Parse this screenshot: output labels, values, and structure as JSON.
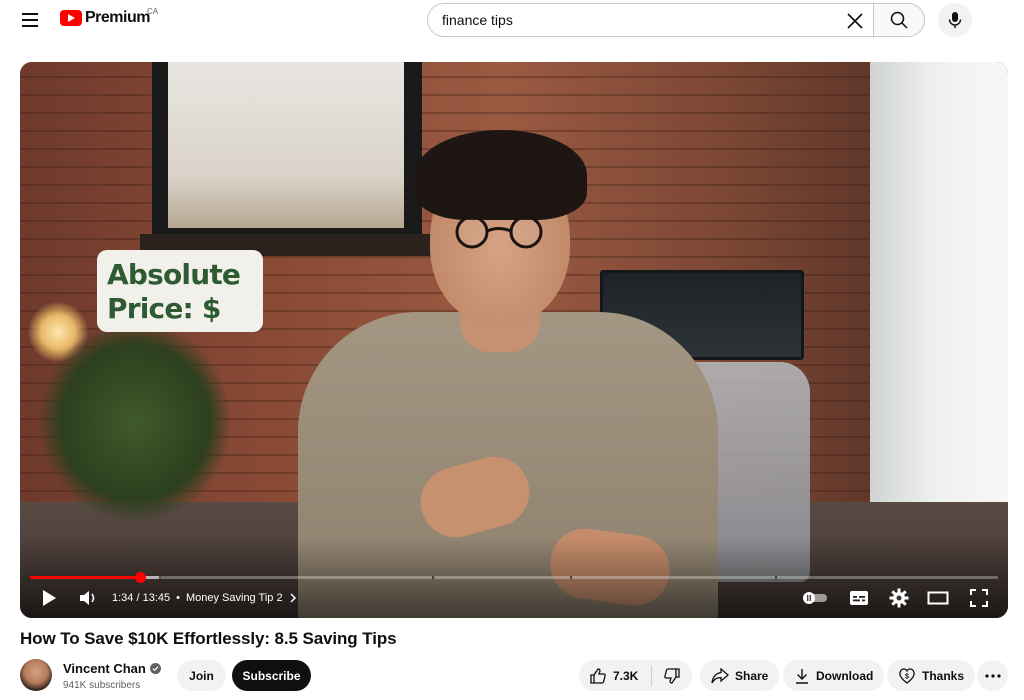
{
  "header": {
    "logo_text": "Premium",
    "country_code": "CA",
    "search": {
      "value": "finance tips",
      "placeholder": "Search"
    }
  },
  "player": {
    "overlay_text": [
      "Absolute",
      "Price: $"
    ],
    "current_time": "1:34",
    "duration": "13:45",
    "time_display": "1:34 / 13:45",
    "chapter_title": "Money Saving Tip 2",
    "progress_played": 0.114,
    "progress_loaded": 0.135
  },
  "video": {
    "title": "How To Save $10K Effortlessly: 8.5 Saving Tips"
  },
  "channel": {
    "name": "Vincent Chan",
    "subscribers": "941K subscribers",
    "join_label": "Join",
    "subscribe_label": "Subscribe"
  },
  "actions": {
    "like_count": "7.3K",
    "share_label": "Share",
    "download_label": "Download",
    "thanks_label": "Thanks"
  },
  "colors": {
    "brand_red": "#ff0000",
    "overlay_green": "#2f5b33",
    "pill_bg": "#f2f2f2"
  }
}
